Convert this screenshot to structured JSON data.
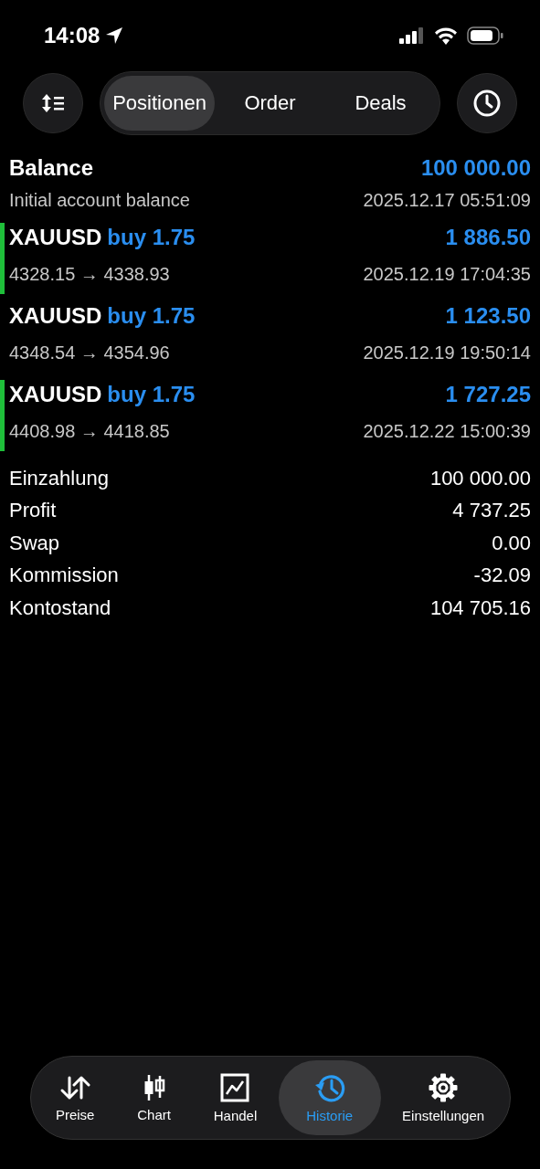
{
  "status_bar": {
    "time": "14:08"
  },
  "toolbar": {
    "segments": [
      {
        "label": "Positionen",
        "selected": true
      },
      {
        "label": "Order",
        "selected": false
      },
      {
        "label": "Deals",
        "selected": false
      }
    ]
  },
  "deals": [
    {
      "kind": "balance",
      "title": "Balance",
      "amount": "100 000.00",
      "comment": "Initial account balance",
      "time": "2025.12.17 05:51:09",
      "marked": false
    },
    {
      "kind": "trade",
      "title": "XAUUSD",
      "trade": "buy 1.75",
      "amount": "1 886.50",
      "comment": "4328.15 → 4338.93",
      "time": "2025.12.19 17:04:35",
      "marked": true
    },
    {
      "kind": "trade",
      "title": "XAUUSD",
      "trade": "buy 1.75",
      "amount": "1 123.50",
      "comment": "4348.54 → 4354.96",
      "time": "2025.12.19 19:50:14",
      "marked": false
    },
    {
      "kind": "trade",
      "title": "XAUUSD",
      "trade": "buy 1.75",
      "amount": "1 727.25",
      "comment": "4408.98 → 4418.85",
      "time": "2025.12.22 15:00:39",
      "marked": true
    }
  ],
  "summary": [
    {
      "label": "Einzahlung",
      "value": "100 000.00"
    },
    {
      "label": "Profit",
      "value": "4 737.25"
    },
    {
      "label": "Swap",
      "value": "0.00"
    },
    {
      "label": "Kommission",
      "value": "-32.09"
    },
    {
      "label": "Kontostand",
      "value": "104 705.16"
    }
  ],
  "tab_bar": [
    {
      "kind": "prices",
      "label": "Preise",
      "selected": false
    },
    {
      "kind": "chart",
      "label": "Chart",
      "selected": false
    },
    {
      "kind": "trade",
      "label": "Handel",
      "selected": false
    },
    {
      "kind": "history",
      "label": "Historie",
      "selected": true
    },
    {
      "kind": "settings",
      "label": "Einstellungen",
      "selected": false
    }
  ]
}
